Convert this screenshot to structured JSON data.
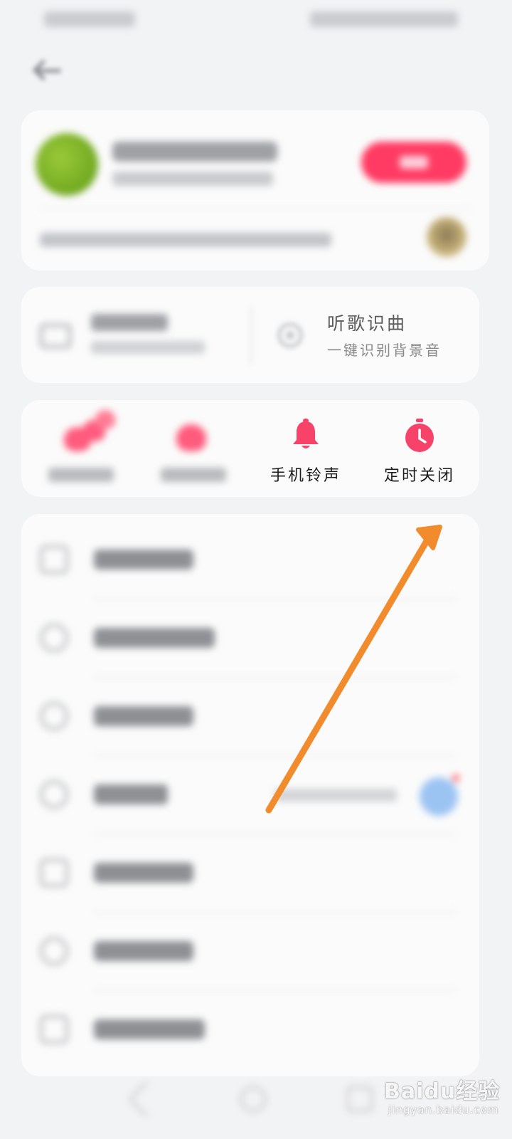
{
  "features": {
    "recognize": {
      "title": "听歌识曲",
      "subtitle": "一键识别背景音"
    }
  },
  "quick_actions": {
    "ringtone_label": "手机铃声",
    "timer_label": "定时关闭",
    "accent_color": "#f7426a"
  },
  "watermark": {
    "main": "Baidu经验",
    "sub": "jingyan.baidu.com"
  },
  "annotation": {
    "arrow_color": "#f28b2c"
  }
}
